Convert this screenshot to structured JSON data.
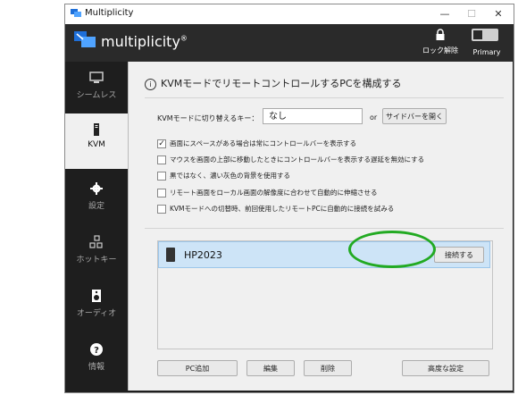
{
  "window": {
    "title": "Multiplicity",
    "minimize": "—",
    "maximize": "☐",
    "close": "✕"
  },
  "header": {
    "brand": "multiplicity",
    "brand_mark": "®",
    "lock_label": "ロック解除",
    "primary_label": "Primary",
    "accent": "#2a2a2a"
  },
  "sidebar": {
    "items": [
      {
        "label": "シームレス",
        "icon": "monitor-icon"
      },
      {
        "label": "KVM",
        "icon": "pc-tower-icon"
      },
      {
        "label": "設定",
        "icon": "gear-icon"
      },
      {
        "label": "ホットキー",
        "icon": "hotkey-icon"
      },
      {
        "label": "オーディオ",
        "icon": "speaker-icon"
      },
      {
        "label": "情報",
        "icon": "help-icon"
      }
    ],
    "active": "KVM"
  },
  "main": {
    "heading": "KVMモードでリモートコントロールするPCを構成する",
    "switch_key_label": "KVMモードに切り替えるキー：",
    "switch_key_value": "なし",
    "or_label": "or",
    "open_sidebar_button": "サイドバーを開く",
    "options": [
      {
        "label": "画面にスペースがある場合は常にコントロールバーを表示する",
        "checked": true
      },
      {
        "label": "マウスを画面の上部に移動したときにコントロールバーを表示する遅延を無効にする",
        "checked": false
      },
      {
        "label": "黒ではなく、濃い灰色の背景を使用する",
        "checked": false
      },
      {
        "label": "リモート画面をローカル画面の解像度に合わせて自動的に伸縮させる",
        "checked": false
      },
      {
        "label": "KVMモードへの切替時、前回使用したリモートPCに自動的に接続を試みる",
        "checked": false
      }
    ],
    "pcs": [
      {
        "name": "HP2023",
        "connect_label": "接続する"
      }
    ],
    "add_pc_button": "PC追加",
    "edit_button": "編集",
    "delete_button": "削除",
    "advanced_button": "高度な設定"
  },
  "colors": {
    "selection": "#cde4f7",
    "highlight_ring": "#22aa22"
  }
}
